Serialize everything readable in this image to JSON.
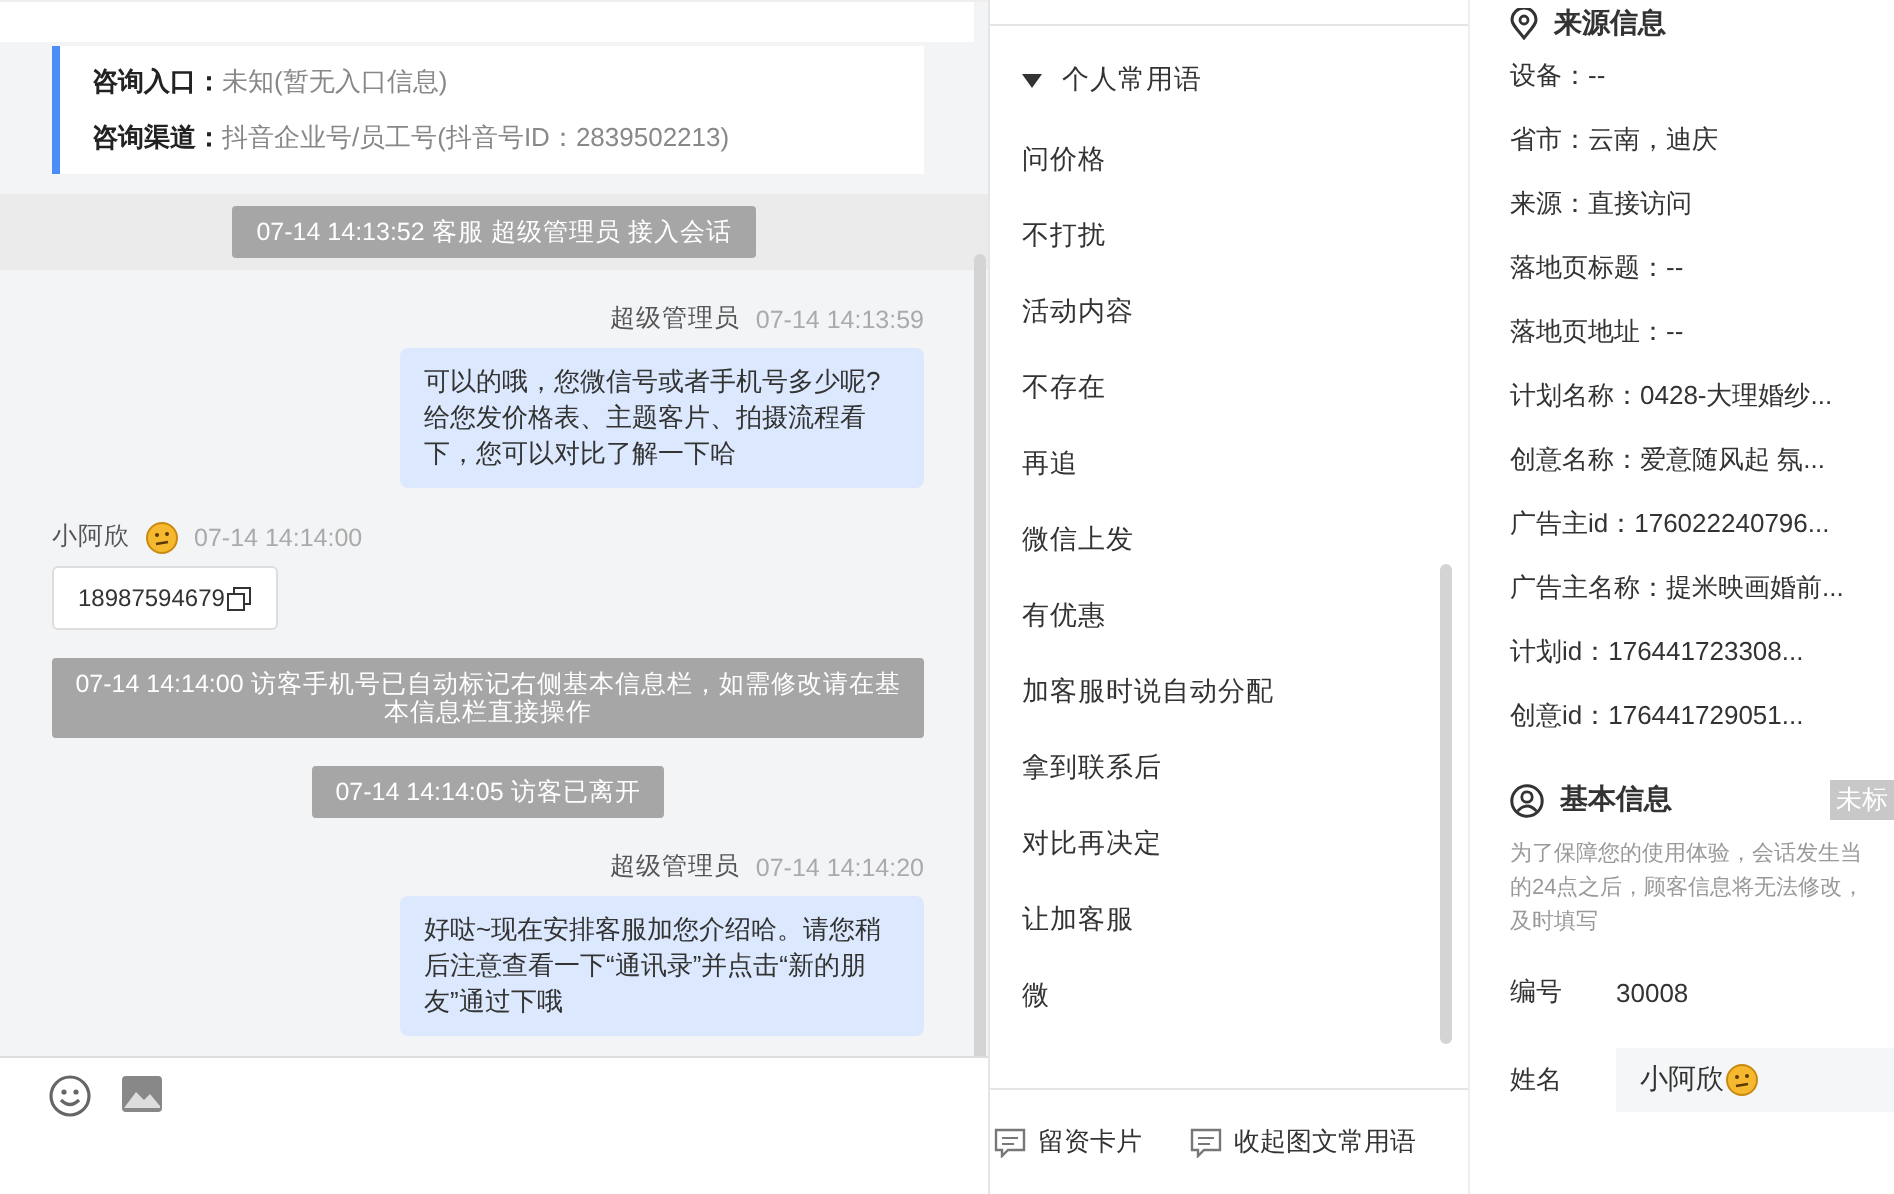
{
  "chat": {
    "entry_card": [
      {
        "label": "咨询入口：",
        "value": "未知(暂无入口信息)"
      },
      {
        "label": "咨询渠道：",
        "value": "抖音企业号/员工号(抖音号ID：2839502213)"
      }
    ],
    "messages": [
      {
        "kind": "system",
        "text": "07-14 14:13:52 客服 超级管理员 接入会话"
      },
      {
        "kind": "agent",
        "sender": "超级管理员",
        "time": "07-14 14:13:59",
        "text": "可以的哦，您微信号或者手机号多少呢?给您发价格表、主题客片、拍摄流程看下，您可以对比了解一下哈"
      },
      {
        "kind": "visitor",
        "sender": "小阿欣",
        "time": "07-14 14:14:00",
        "text": "18987594679"
      },
      {
        "kind": "system",
        "text": "07-14 14:14:00 访客手机号已自动标记右侧基本信息栏，如需修改请在基本信息栏直接操作"
      },
      {
        "kind": "system",
        "text": "07-14 14:14:05 访客已离开"
      },
      {
        "kind": "agent",
        "sender": "超级管理员",
        "time": "07-14 14:14:20",
        "text": "好哒~现在安排客服加您介绍哈。请您稍后注意查看一下“通讯录”并点击“新的朋友”通过下哦"
      }
    ]
  },
  "phrases": {
    "group": {
      "label": "个人常用语",
      "expanded": true
    },
    "items": [
      "问价格",
      "不打扰",
      "活动内容",
      "不存在",
      "再追",
      "微信上发",
      "有优惠",
      "加客服时说自动分配",
      "拿到联系后",
      "对比再决定",
      "让加客服",
      "微"
    ],
    "footer": [
      "留资卡片",
      "收起图文常用语"
    ]
  },
  "info": {
    "source": {
      "title": "来源信息",
      "rows": [
        "设备：--",
        "省市：云南，迪庆",
        "来源：直接访问",
        "落地页标题：--",
        "落地页地址：--",
        "计划名称：0428-大理婚纱...",
        "创意名称：爱意随风起 氛...",
        "广告主id：176022240796...",
        "广告主名称：提米映画婚前...",
        "计划id：176441723308...",
        "创意id：176441729051..."
      ]
    },
    "basic": {
      "title": "基本信息",
      "tag": "未标",
      "hint": [
        "为了保障您的使用体验，会话发生当",
        "的24点之后，顾客信息将无法修改，",
        "及时填写"
      ],
      "fields": [
        {
          "label": "编号",
          "value": "30008",
          "kind": "text"
        },
        {
          "label": "姓名",
          "value": "小阿欣",
          "kind": "input"
        }
      ]
    }
  }
}
